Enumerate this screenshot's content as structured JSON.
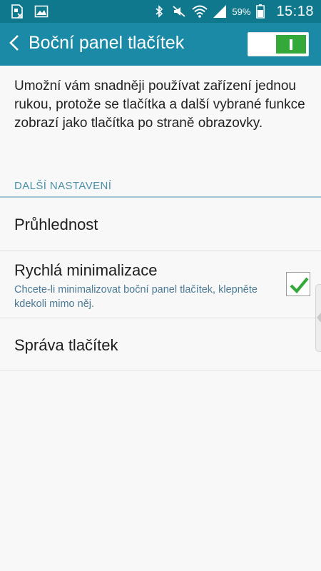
{
  "status_bar": {
    "battery_percent": "59%",
    "time": "15:18",
    "icons": [
      "sim-card-icon",
      "image-icon",
      "bluetooth-icon",
      "mute-icon",
      "wifi-icon",
      "signal-icon",
      "battery-icon"
    ]
  },
  "action_bar": {
    "title": "Boční panel tlačítek",
    "master_switch_on": true
  },
  "description": "Umožní vám snadněji používat zařízení jednou rukou, protože se tlačítka a další vybrané funkce zobrazí jako tlačítka po straně obrazovky.",
  "section": {
    "header": "DALŠÍ NASTAVENÍ"
  },
  "items": [
    {
      "title": "Průhlednost"
    },
    {
      "title": "Rychlá minimalizace",
      "subtitle": "Chcete-li minimalizovat boční panel tlačítek, klepněte kdekoli mimo něj.",
      "checked": true
    },
    {
      "title": "Správa tlačítek"
    }
  ],
  "colors": {
    "status_bar": "#10788c",
    "action_bar": "#1a8aa6",
    "accent_green": "#35a83a",
    "section_header": "#4a90a6",
    "subtitle": "#4a7a96"
  }
}
